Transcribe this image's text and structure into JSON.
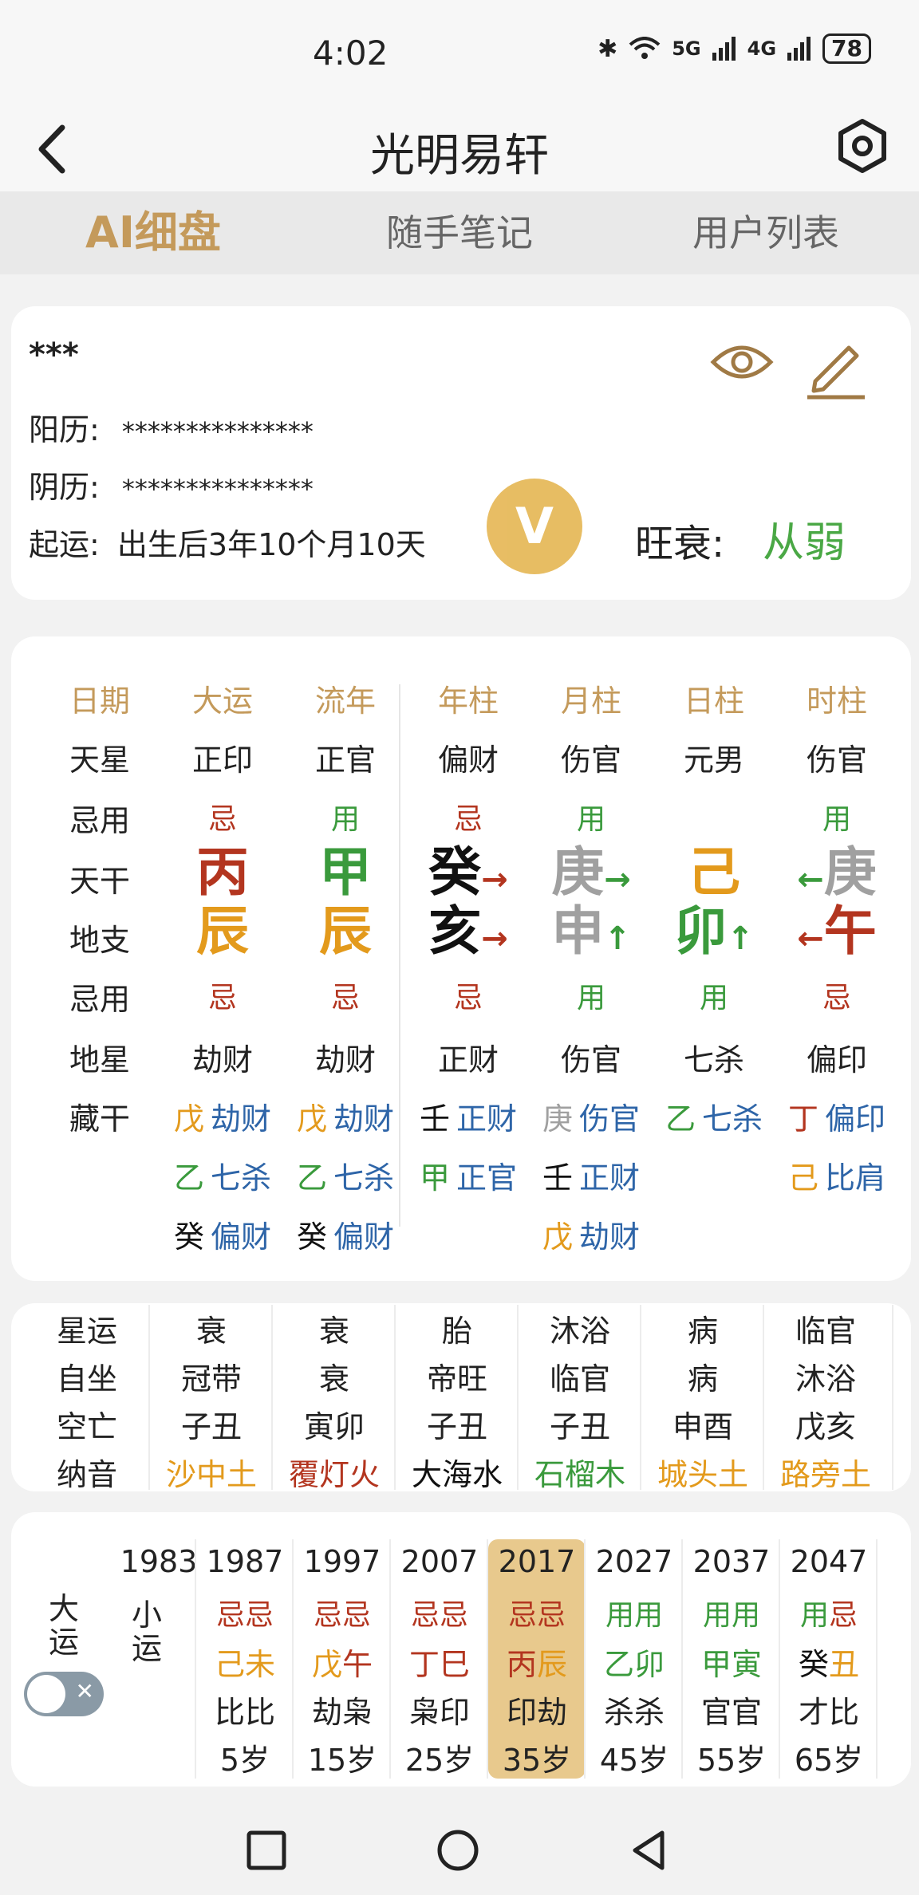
{
  "status": {
    "time": "4:02",
    "net1": "5G",
    "net2": "4G",
    "battery": "78"
  },
  "header": {
    "title": "光明易轩"
  },
  "tabs": [
    {
      "label": "AI细盘",
      "active": true
    },
    {
      "label": "随手笔记",
      "active": false
    },
    {
      "label": "用户列表",
      "active": false
    }
  ],
  "profile": {
    "name": "***",
    "solar_label": "阳历:",
    "solar_value": "***************",
    "lunar_label": "阴历:",
    "lunar_value": "***************",
    "qiyun_label": "起运:",
    "qiyun_value": "出生后3年10个月10天",
    "wangshuai_label": "旺衰:",
    "wangshuai_value": "从弱",
    "vip_badge": "V"
  },
  "chart": {
    "headers": [
      "日期",
      "大运",
      "流年",
      "年柱",
      "月柱",
      "日柱",
      "时柱"
    ],
    "row_labels": [
      "天星",
      "忌用",
      "天干",
      "地支",
      "忌用",
      "地星",
      "藏干"
    ],
    "tianxing": [
      "正印",
      "正官",
      "偏财",
      "伤官",
      "元男",
      "伤官"
    ],
    "jiyong_top": [
      {
        "t": "忌",
        "c": "red"
      },
      {
        "t": "用",
        "c": "green"
      },
      {
        "t": "忌",
        "c": "red"
      },
      {
        "t": "用",
        "c": "green"
      },
      {
        "t": "",
        "c": "green"
      },
      {
        "t": "用",
        "c": "green"
      }
    ],
    "tiangan": [
      {
        "t": "丙",
        "c": "red",
        "arrow": ""
      },
      {
        "t": "甲",
        "c": "green",
        "arrow": ""
      },
      {
        "t": "癸",
        "c": "black",
        "arrow": "→",
        "ac": "red"
      },
      {
        "t": "庚",
        "c": "gray",
        "arrow": "→",
        "ac": "green"
      },
      {
        "t": "己",
        "c": "orange",
        "arrow": ""
      },
      {
        "t": "庚",
        "c": "gray",
        "arrow": "←",
        "ac": "green",
        "left": true
      }
    ],
    "dizhi": [
      {
        "t": "辰",
        "c": "orange",
        "arrow": ""
      },
      {
        "t": "辰",
        "c": "orange",
        "arrow": ""
      },
      {
        "t": "亥",
        "c": "black",
        "arrow": "→",
        "ac": "red"
      },
      {
        "t": "申",
        "c": "gray",
        "arrow": "↑",
        "ac": "green"
      },
      {
        "t": "卯",
        "c": "green",
        "arrow": "↑",
        "ac": "green"
      },
      {
        "t": "午",
        "c": "red",
        "arrow": "←",
        "ac": "red",
        "left": true
      }
    ],
    "jiyong_bottom": [
      {
        "t": "忌",
        "c": "red"
      },
      {
        "t": "忌",
        "c": "red"
      },
      {
        "t": "忌",
        "c": "red"
      },
      {
        "t": "用",
        "c": "green"
      },
      {
        "t": "用",
        "c": "green"
      },
      {
        "t": "忌",
        "c": "red"
      }
    ],
    "dixing": [
      "劫财",
      "劫财",
      "正财",
      "伤官",
      "七杀",
      "偏印"
    ],
    "canggan": [
      [
        {
          "g": "戊",
          "gc": "orange",
          "s": "劫财"
        },
        {
          "g": "乙",
          "gc": "green",
          "s": "七杀"
        },
        {
          "g": "癸",
          "gc": "black",
          "s": "偏财"
        }
      ],
      [
        {
          "g": "戊",
          "gc": "orange",
          "s": "劫财"
        },
        {
          "g": "乙",
          "gc": "green",
          "s": "七杀"
        },
        {
          "g": "癸",
          "gc": "black",
          "s": "偏财"
        }
      ],
      [
        {
          "g": "壬",
          "gc": "black",
          "s": "正财"
        },
        {
          "g": "甲",
          "gc": "green",
          "s": "正官"
        }
      ],
      [
        {
          "g": "庚",
          "gc": "gray",
          "s": "伤官"
        },
        {
          "g": "壬",
          "gc": "black",
          "s": "正财"
        },
        {
          "g": "戊",
          "gc": "orange",
          "s": "劫财"
        }
      ],
      [
        {
          "g": "乙",
          "gc": "green",
          "s": "七杀"
        }
      ],
      [
        {
          "g": "丁",
          "gc": "red",
          "s": "偏印"
        },
        {
          "g": "己",
          "gc": "orange",
          "s": "比肩"
        }
      ]
    ]
  },
  "shensha": {
    "labels": [
      "星运",
      "自坐",
      "空亡",
      "纳音"
    ],
    "columns": [
      [
        "衰",
        "冠带",
        "子丑",
        {
          "t": "沙中土",
          "c": "orange"
        }
      ],
      [
        "衰",
        "衰",
        "寅卯",
        {
          "t": "覆灯火",
          "c": "red"
        }
      ],
      [
        "胎",
        "帝旺",
        "子丑",
        {
          "t": "大海水",
          "c": "black"
        }
      ],
      [
        "沐浴",
        "临官",
        "子丑",
        {
          "t": "石榴木",
          "c": "green"
        }
      ],
      [
        "病",
        "病",
        "申酉",
        {
          "t": "城头土",
          "c": "orange"
        }
      ],
      [
        "临官",
        "沐浴",
        "戊亥",
        {
          "t": "路旁土",
          "c": "orange"
        }
      ]
    ]
  },
  "dayun": {
    "label_dayun": "大运",
    "label_xiaoyun": "小运",
    "first_year": "1983",
    "columns": [
      {
        "year": "1987",
        "jy": [
          [
            "忌",
            "red"
          ],
          [
            "忌",
            "red"
          ]
        ],
        "gz": [
          [
            "己",
            "orange"
          ],
          [
            "未",
            "orange"
          ]
        ],
        "ss": "比比",
        "age": "5岁"
      },
      {
        "year": "1997",
        "jy": [
          [
            "忌",
            "red"
          ],
          [
            "忌",
            "red"
          ]
        ],
        "gz": [
          [
            "戊",
            "orange"
          ],
          [
            "午",
            "red"
          ]
        ],
        "ss": "劫枭",
        "age": "15岁"
      },
      {
        "year": "2007",
        "jy": [
          [
            "忌",
            "red"
          ],
          [
            "忌",
            "red"
          ]
        ],
        "gz": [
          [
            "丁",
            "red"
          ],
          [
            "巳",
            "red"
          ]
        ],
        "ss": "枭印",
        "age": "25岁"
      },
      {
        "year": "2017",
        "jy": [
          [
            "忌",
            "red"
          ],
          [
            "忌",
            "red"
          ]
        ],
        "gz": [
          [
            "丙",
            "red"
          ],
          [
            "辰",
            "orange"
          ]
        ],
        "ss": "印劫",
        "age": "35岁",
        "active": true
      },
      {
        "year": "2027",
        "jy": [
          [
            "用",
            "green"
          ],
          [
            "用",
            "green"
          ]
        ],
        "gz": [
          [
            "乙",
            "green"
          ],
          [
            "卯",
            "green"
          ]
        ],
        "ss": "杀杀",
        "age": "45岁"
      },
      {
        "year": "2037",
        "jy": [
          [
            "用",
            "green"
          ],
          [
            "用",
            "green"
          ]
        ],
        "gz": [
          [
            "甲",
            "green"
          ],
          [
            "寅",
            "green"
          ]
        ],
        "ss": "官官",
        "age": "55岁"
      },
      {
        "year": "2047",
        "jy": [
          [
            "用",
            "green"
          ],
          [
            "忌",
            "red"
          ]
        ],
        "gz": [
          [
            "癸",
            "black"
          ],
          [
            "丑",
            "orange"
          ]
        ],
        "ss": "才比",
        "age": "65岁"
      }
    ]
  },
  "colors": {
    "accent": "#c49a5b",
    "red": "#b3351f",
    "green": "#3a9a3c",
    "orange": "#e39a1c",
    "blue": "#2e65a8",
    "gray": "#a0a0a0",
    "black": "#111111"
  },
  "icons": [
    "back-arrow-icon",
    "settings-hexagon-icon",
    "eye-icon",
    "edit-pencil-icon",
    "square-nav-icon",
    "circle-nav-icon",
    "triangle-back-nav-icon"
  ]
}
